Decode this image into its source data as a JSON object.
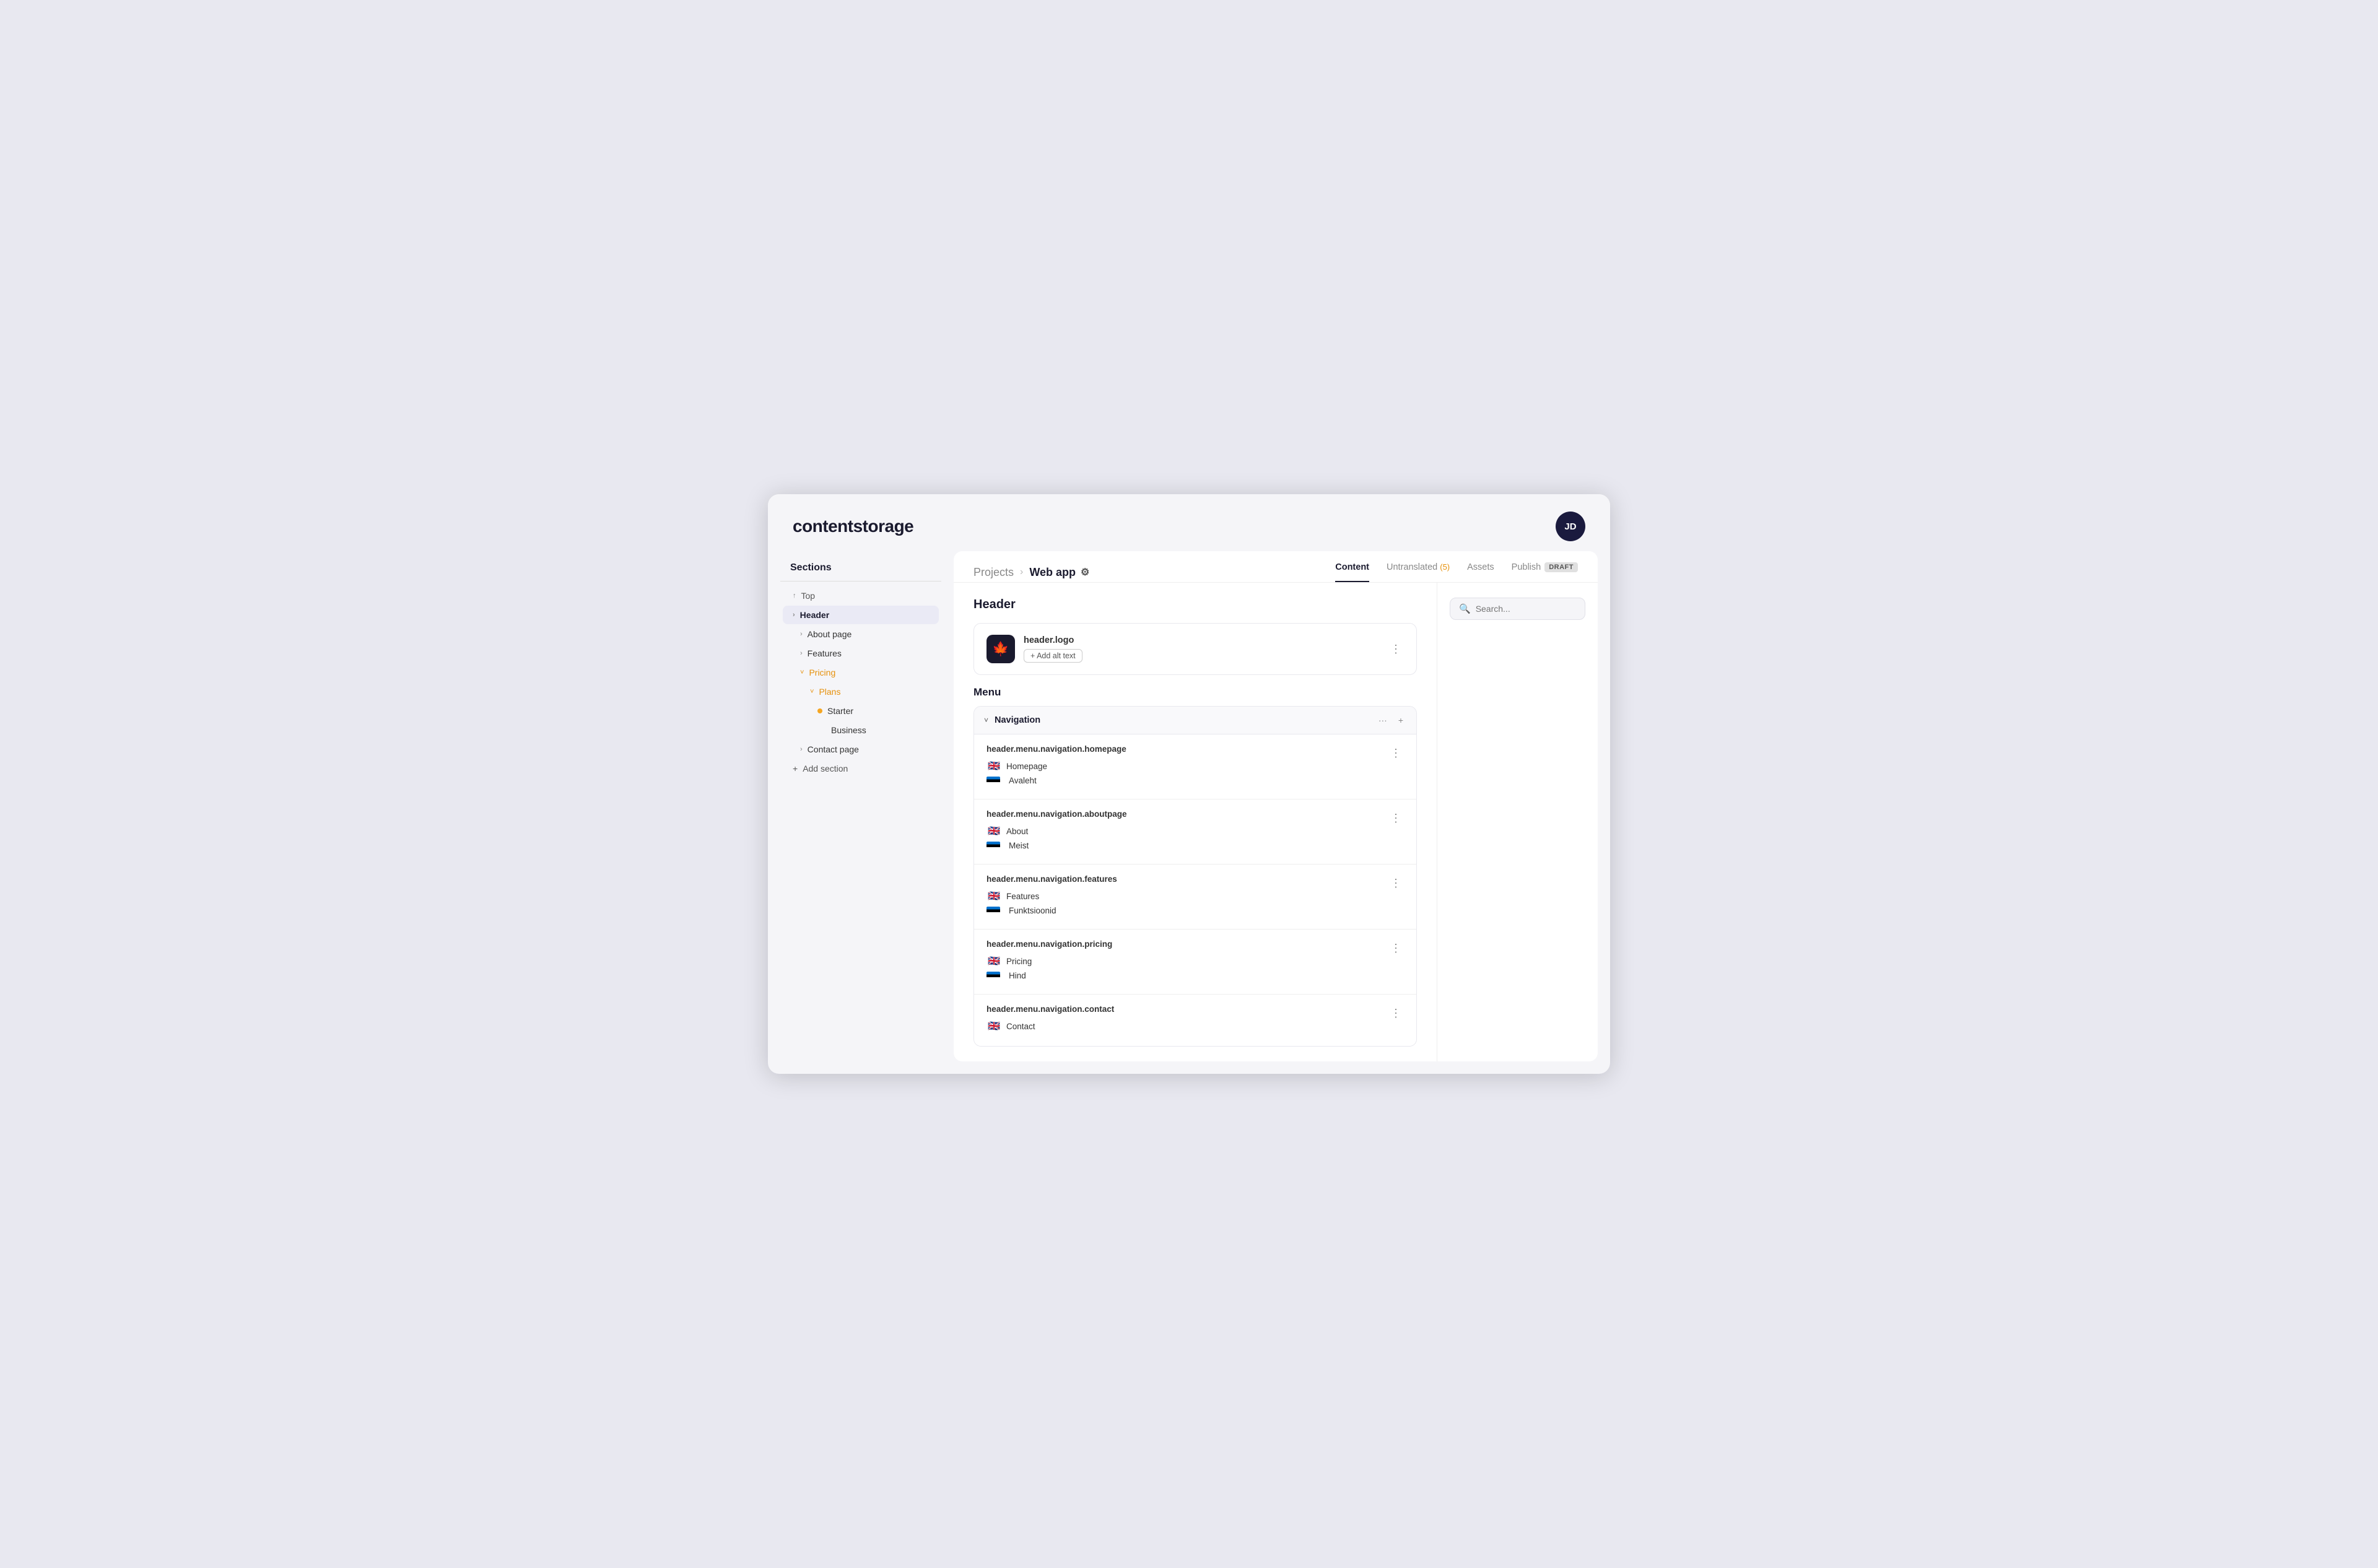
{
  "app": {
    "title": "contentstorage",
    "avatar": "JD"
  },
  "breadcrumb": {
    "projects_label": "Projects",
    "separator": "›",
    "current": "Web app"
  },
  "tabs": [
    {
      "id": "content",
      "label": "Content",
      "active": true
    },
    {
      "id": "untranslated",
      "label": "Untranslated",
      "badge": "(5)",
      "active": false
    },
    {
      "id": "assets",
      "label": "Assets",
      "active": false
    },
    {
      "id": "publish",
      "label": "Publish",
      "draft": "DRAFT",
      "active": false
    }
  ],
  "sidebar": {
    "title": "Sections",
    "items": [
      {
        "id": "top",
        "label": "Top",
        "icon": "↑",
        "indent": 0,
        "type": "arrow"
      },
      {
        "id": "header",
        "label": "Header",
        "icon": "›",
        "indent": 0,
        "active": true
      },
      {
        "id": "about-page",
        "label": "About page",
        "icon": "›",
        "indent": 1
      },
      {
        "id": "features",
        "label": "Features",
        "icon": "›",
        "indent": 1
      },
      {
        "id": "pricing",
        "label": "Pricing",
        "icon": "˅",
        "indent": 1,
        "type": "expanded",
        "color": "orange"
      },
      {
        "id": "plans",
        "label": "Plans",
        "icon": "˅",
        "indent": 2,
        "type": "expanded",
        "color": "orange"
      },
      {
        "id": "starter",
        "label": "Starter",
        "icon": "dot",
        "indent": 3,
        "color": "orange"
      },
      {
        "id": "business",
        "label": "Business",
        "icon": "",
        "indent": 3
      },
      {
        "id": "contact-page",
        "label": "Contact page",
        "icon": "›",
        "indent": 1
      },
      {
        "id": "add-section",
        "label": "Add section",
        "icon": "+",
        "indent": 0,
        "type": "add"
      }
    ]
  },
  "header_section": {
    "label": "Header",
    "logo_card": {
      "key_prefix": "header.",
      "key_bold": "logo",
      "add_alt_label": "+ Add alt text"
    },
    "menu_label": "Menu",
    "navigation": {
      "label": "Navigation",
      "items": [
        {
          "key_prefix": "header.menu.navigation.",
          "key_bold": "homepage",
          "en_text": "Homepage",
          "et_text": "Avaleht"
        },
        {
          "key_prefix": "header.menu.navigation.",
          "key_bold": "aboutpage",
          "en_text": "About",
          "et_text": "Meist"
        },
        {
          "key_prefix": "header.menu.navigation.",
          "key_bold": "features",
          "en_text": "Features",
          "et_text": "Funktsioonid"
        },
        {
          "key_prefix": "header.menu.navigation.",
          "key_bold": "pricing",
          "en_text": "Pricing",
          "et_text": "Hind"
        },
        {
          "key_prefix": "header.menu.navigation.",
          "key_bold": "contact",
          "en_text": "Contact",
          "et_text": ""
        }
      ]
    }
  },
  "search": {
    "placeholder": "Search..."
  },
  "icons": {
    "three_dots": "⋮",
    "chevron_down": "˅",
    "chevron_right": "›",
    "plus": "+",
    "search": "🔍",
    "gear": "⚙",
    "dots_more": "···"
  }
}
